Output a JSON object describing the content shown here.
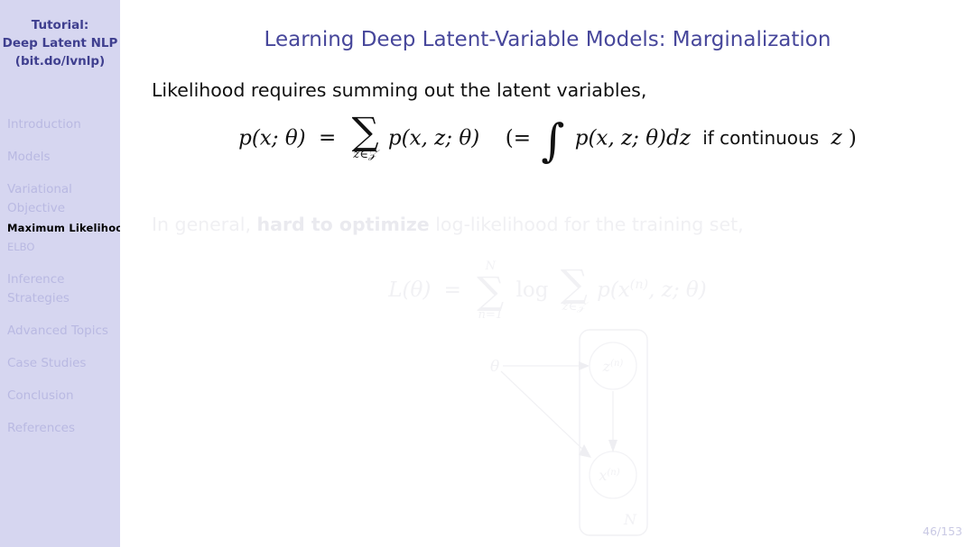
{
  "sidebar": {
    "header_lines": [
      "Tutorial:",
      "Deep Latent NLP",
      "(bit.do/lvnlp)"
    ],
    "sections": [
      {
        "label": "Introduction",
        "active": false,
        "sub": []
      },
      {
        "label": "Models",
        "active": false,
        "sub": []
      },
      {
        "label": "Variational",
        "label2": "Objective",
        "active": false,
        "sub": [
          {
            "label": "Maximum Likelihood",
            "active": true
          },
          {
            "label": "ELBO",
            "active": false
          }
        ]
      },
      {
        "label": "Inference",
        "label2": "Strategies",
        "active": false,
        "sub": []
      },
      {
        "label": "Advanced Topics",
        "active": false,
        "sub": []
      },
      {
        "label": "Case Studies",
        "active": false,
        "sub": []
      },
      {
        "label": "Conclusion",
        "active": false,
        "sub": []
      },
      {
        "label": "References",
        "active": false,
        "sub": []
      }
    ],
    "background_color": "#d6d6f0",
    "header_color": "#3f3f8f",
    "inactive_color": "#b9b9e2",
    "active_color": "#000000"
  },
  "slide": {
    "title": "Learning Deep Latent-Variable Models: Marginalization",
    "title_color": "#47479b",
    "body_line_1": "Likelihood requires summing out the latent variables,",
    "equation_main": {
      "lhs": "p(x; θ)",
      "equals": "=",
      "sum_operator": "∑",
      "sum_subscript": "z∈𝒵",
      "summand": "p(x, z; θ)",
      "paren_open": "(=",
      "integral_operator": "∫",
      "integrand": "p(x, z; θ)dz",
      "trailing_text": "if continuous",
      "trailing_var": "z",
      "paren_close": ")"
    },
    "body_line_2": {
      "before": "In general, ",
      "bold": "hard to optimize",
      "after": " log-likelihood for the training set,",
      "faded": true
    },
    "equation_faded": {
      "lhs": "L(θ)",
      "equals": "=",
      "sum1_operator": "∑",
      "sum1_top": "N",
      "sum1_bottom": "n=1",
      "log": "log",
      "sum2_operator": "∑",
      "sum2_bottom": "z∈𝒵",
      "summand": "p(x",
      "summand_sup": "(n)",
      "summand_rest": ", z; θ)",
      "faded": true
    },
    "plate_diagram": {
      "theta_label": "θ",
      "node_top_label": "z",
      "node_top_sup": "(n)",
      "node_bottom_label": "x",
      "node_bottom_sup": "(n)",
      "plate_label": "N",
      "faded": true,
      "stroke_color": "#f1f1f4"
    },
    "page_number": "46/153",
    "background_color": "#ffffff"
  }
}
